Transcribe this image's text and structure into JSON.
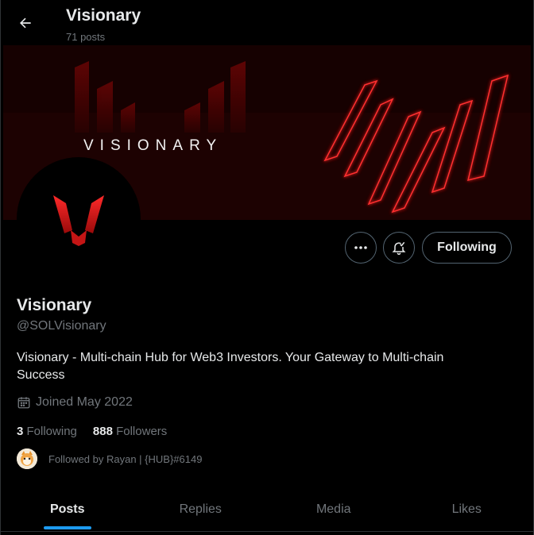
{
  "header": {
    "title": "Visionary",
    "post_count": "71 posts"
  },
  "banner": {
    "wordmark": "VISIONARY"
  },
  "actions": {
    "more_icon": "more-dots-icon",
    "notify_icon": "bell-check-icon",
    "following_label": "Following"
  },
  "profile": {
    "name": "Visionary",
    "handle": "@SOLVisionary",
    "bio": "Visionary - Multi-chain Hub for Web3 Investors. Your Gateway to Multi-chain Success",
    "joined": "Joined May 2022",
    "following_count": "3",
    "following_label": "Following",
    "followers_count": "888",
    "followers_label": "Followers",
    "followed_by": "Followed by Rayan | {HUB}#6149"
  },
  "tabs": [
    {
      "label": "Posts",
      "active": true
    },
    {
      "label": "Replies",
      "active": false
    },
    {
      "label": "Media",
      "active": false
    },
    {
      "label": "Likes",
      "active": false
    }
  ],
  "colors": {
    "accent": "#1d9bf0",
    "brand_red": "#d1121b",
    "muted": "#71767b"
  }
}
